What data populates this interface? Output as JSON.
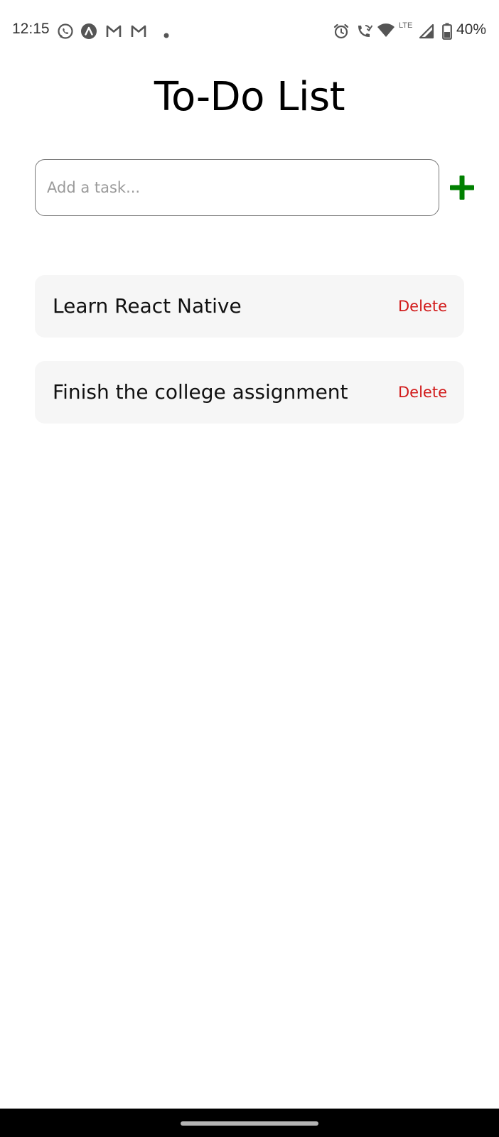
{
  "status_bar": {
    "time": "12:15",
    "battery_percent": "40%",
    "network_label": "LTE",
    "left_icons": [
      "whatsapp-icon",
      "app-a-icon",
      "gmail-icon",
      "gmail-icon",
      "dot-icon"
    ],
    "right_icons": [
      "alarm-icon",
      "wifi-calling-icon",
      "wifi-icon",
      "signal-icon",
      "battery-icon"
    ]
  },
  "app": {
    "title": "To-Do List"
  },
  "input": {
    "placeholder": "Add a task...",
    "value": ""
  },
  "add_button": {
    "icon": "plus-icon",
    "color": "#008000"
  },
  "tasks": [
    {
      "label": "Learn React Native",
      "delete_label": "Delete"
    },
    {
      "label": "Finish the college assignment",
      "delete_label": "Delete"
    }
  ],
  "colors": {
    "delete": "#d11a1a",
    "item_background": "#f6f6f6"
  }
}
